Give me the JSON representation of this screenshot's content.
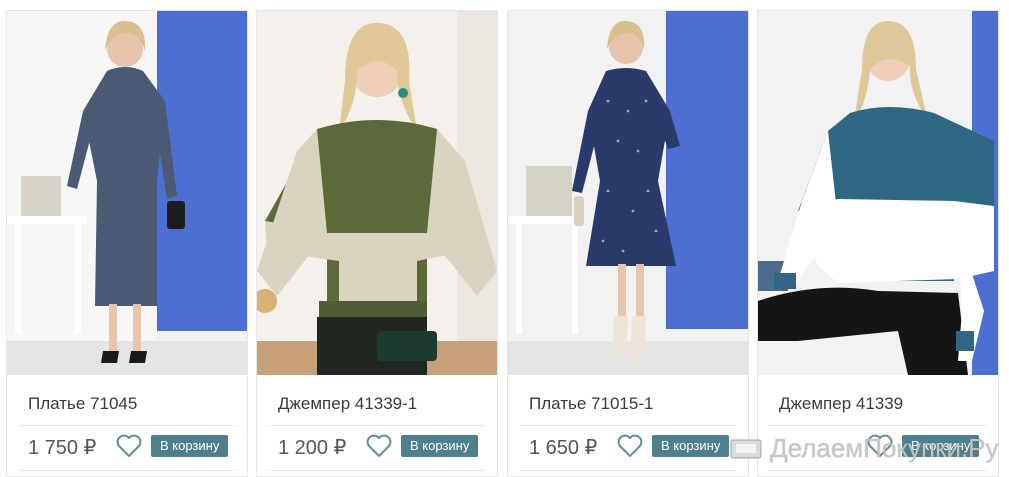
{
  "products": [
    {
      "title": "Платье 71045",
      "price": "1 750 ₽",
      "cart_label": "В корзину",
      "image_icon": "dress-photo"
    },
    {
      "title": "Джемпер 41339-1",
      "price": "1 200 ₽",
      "cart_label": "В корзину",
      "image_icon": "sweater-photo"
    },
    {
      "title": "Платье 71015-1",
      "price": "1 650 ₽",
      "cart_label": "В корзину",
      "image_icon": "dress-photo"
    },
    {
      "title": "Джемпер 41339",
      "price": "",
      "cart_label": "В корзину",
      "image_icon": "sweater-photo"
    }
  ],
  "watermark": {
    "text": "ДелаемПокупки.Ру",
    "icon": "shopping-cart-icon"
  },
  "colors": {
    "button": "#4e7f8c",
    "heart": "#5d8f9a",
    "blue_wall": "#4d6fd1",
    "olive": "#5c6a3a",
    "beige": "#d9d4c0",
    "teal": "#2f6683",
    "navy": "#2a3a6a",
    "slate": "#4a5a75"
  }
}
